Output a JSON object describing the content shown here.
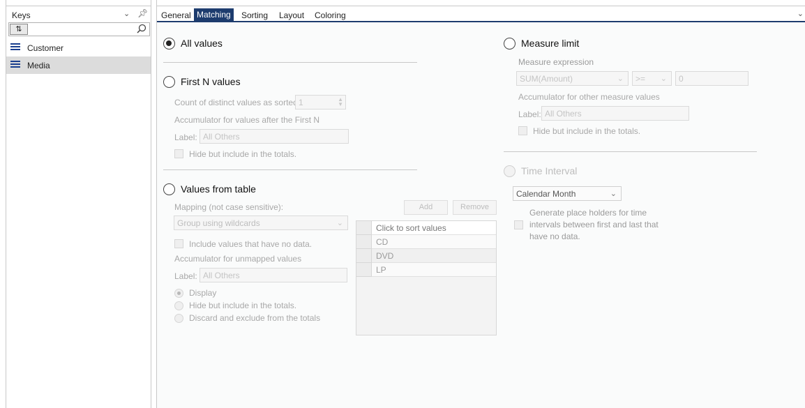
{
  "keys_panel": {
    "title": "Keys",
    "sort_label": "⇅",
    "search_value": "",
    "items": [
      {
        "label": "Customer",
        "selected": false
      },
      {
        "label": "Media",
        "selected": true
      }
    ]
  },
  "tabs": [
    {
      "label": "General",
      "active": false
    },
    {
      "label": "Matching",
      "active": true
    },
    {
      "label": "Sorting",
      "active": false
    },
    {
      "label": "Layout",
      "active": false
    },
    {
      "label": "Coloring",
      "active": false
    }
  ],
  "matching": {
    "all_values": {
      "label": "All values",
      "selected": true
    },
    "first_n": {
      "label": "First N values",
      "count_label": "Count of distinct values as sorted:",
      "count_value": "1",
      "accumulator_label": "Accumulator for values after the First N",
      "label_caption": "Label:",
      "label_value": "All Others",
      "hide_label": "Hide but include in the totals."
    },
    "values_from_table": {
      "label": "Values from table",
      "mapping_label": "Mapping (not case sensitive):",
      "mapping_value": "Group using wildcards",
      "add_label": "Add",
      "remove_label": "Remove",
      "table_header": "Click to sort values",
      "table_values": [
        "CD",
        "DVD",
        "LP"
      ],
      "include_no_data_label": "Include values that have no data.",
      "accumulator_label": "Accumulator for unmapped values",
      "label_caption": "Label:",
      "label_value": "All Others",
      "options": [
        {
          "label": "Display",
          "selected": true
        },
        {
          "label": "Hide but include in the totals.",
          "selected": false
        },
        {
          "label": "Discard and exclude from the totals",
          "selected": false
        }
      ]
    },
    "measure_limit": {
      "label": "Measure limit",
      "expression_label": "Measure expression",
      "expression_value": "SUM(Amount)",
      "operator_value": ">=",
      "threshold_value": "0",
      "accumulator_label": "Accumulator for other measure values",
      "label_caption": "Label:",
      "label_value": "All Others",
      "hide_label": "Hide but include in the totals."
    },
    "time_interval": {
      "label": "Time Interval",
      "interval_value": "Calendar Month",
      "placeholder_line1": "Generate place holders for time",
      "placeholder_line2": "intervals between first and last that",
      "placeholder_line3": "have no data."
    }
  }
}
